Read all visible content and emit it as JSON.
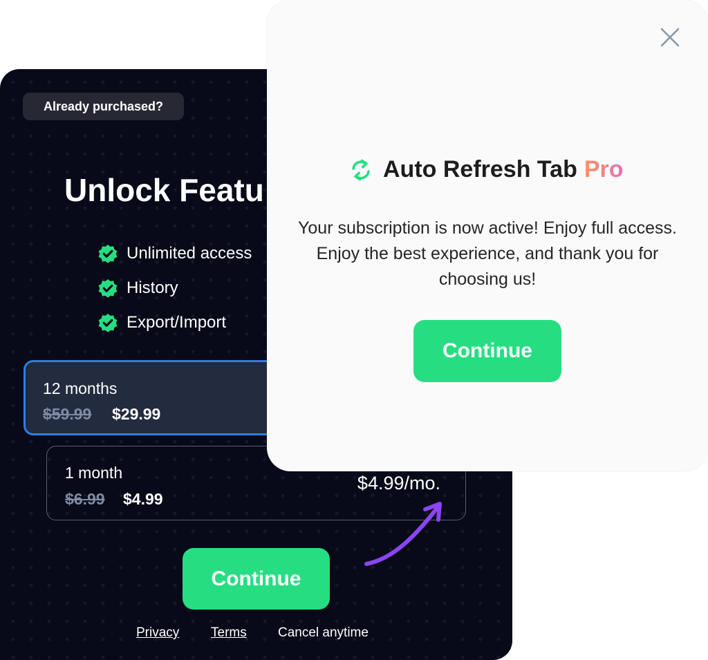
{
  "paywall": {
    "already_purchased": "Already purchased?",
    "headline": "Unlock Featu",
    "features": [
      {
        "label": "Unlimited access",
        "icon": "check-badge-icon"
      },
      {
        "label": "History",
        "icon": "check-badge-icon"
      },
      {
        "label": "Export/Import",
        "icon": "check-badge-icon"
      }
    ],
    "plans": [
      {
        "name": "12 months",
        "old_price": "$59.99",
        "price": "$29.99",
        "selected": true
      },
      {
        "name": "1 month",
        "old_price": "$6.99",
        "price": "$4.99",
        "per_month": "$4.99/mo.",
        "selected": false
      }
    ],
    "continue_label": "Continue",
    "footer": {
      "privacy": "Privacy",
      "terms": "Terms",
      "cancel": "Cancel anytime"
    }
  },
  "popup": {
    "brand_name": "Auto Refresh Tab",
    "brand_pro": "Pro",
    "message": "Your subscription is now active! Enjoy full access. Enjoy the best experience, and thank you for choosing us!",
    "continue_label": "Continue",
    "close_icon": "close-icon",
    "brand_icon": "refresh-icon"
  },
  "colors": {
    "accent_green": "#26de81",
    "selected_border": "#2f7de1",
    "panel_bg": "#090a19",
    "pro_gradient_start": "#f5955a",
    "pro_gradient_end": "#e76fb9",
    "arrow_purple": "#8b45f2"
  }
}
